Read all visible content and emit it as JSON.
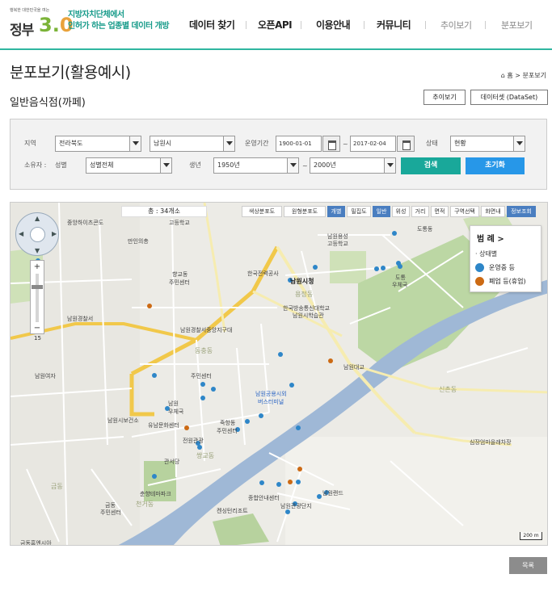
{
  "header": {
    "logo_tiny": "행복한 대한민국을 여는",
    "logo_gov": "정부",
    "logo_three": "3.",
    "logo_zero": "0",
    "slogan_line1": "지방자치단체에서",
    "slogan_line2": "인허가 하는 업종별 데이터 개방",
    "menu": [
      {
        "label": "데이터 찾기"
      },
      {
        "label": "오픈API"
      },
      {
        "label": "이용안내"
      },
      {
        "label": "커뮤니티"
      },
      {
        "label": "추이보기"
      },
      {
        "label": "분포보기"
      }
    ],
    "accent_color": "#2fb6a0"
  },
  "page": {
    "title": "분포보기(활용예시)",
    "breadcrumb": "⌂ 홈 > 분포보기",
    "subtitle": "일반음식점(까페)",
    "trend_button": "추이보기",
    "dataset_button": "데이터셋 (DataSet)"
  },
  "search": {
    "region_label": "지역",
    "province": "전라북도",
    "city": "남원시",
    "period_label": "운영기간",
    "date_from": "1900-01-01",
    "date_to": "2017-02-04",
    "status_label": "상태",
    "status_value": "현황",
    "owner_label": "소유자 :",
    "gender_label": "성별",
    "gender_value": "성별전체",
    "birth_label": "생년",
    "birth_from": "1950년",
    "birth_to": "2000년",
    "tilde": "~",
    "search_button": "검색",
    "reset_button": "초기화",
    "search_color": "#19a89a",
    "reset_color": "#2797e8"
  },
  "map": {
    "count_text": "총 : 34개소",
    "toolbar": [
      {
        "label": "색상분포도",
        "active": false
      },
      {
        "label": "원형분포도",
        "active": false
      },
      {
        "label": "개별",
        "active": true
      },
      {
        "label": "밀집도",
        "active": false
      },
      {
        "label": "일반",
        "active": true
      },
      {
        "label": "위성",
        "active": false
      },
      {
        "label": "거리",
        "active": false
      },
      {
        "label": "면적",
        "active": false
      },
      {
        "label": "구역선택",
        "active": false
      },
      {
        "label": "화면내",
        "active": false
      },
      {
        "label": "정보조회",
        "active": true
      }
    ],
    "legend_title": "범 례 >",
    "legend_sub": "· 상태별",
    "legend_items": [
      {
        "label": "운영중 등",
        "color": "#2e86c8"
      },
      {
        "label": "폐업 등(휴업)",
        "color": "#cc6a14"
      }
    ],
    "zoom_plus": "+",
    "zoom_minus": "−",
    "zoom_level": "15",
    "scale": "200 m",
    "labels": [
      {
        "text": "중앙하이츠콘도"
      },
      {
        "text": "고등학교"
      },
      {
        "text": "만인의총"
      },
      {
        "text": "향교동"
      },
      {
        "text": "주민센터"
      },
      {
        "text": "남원시청"
      },
      {
        "text": "한국전력공사"
      },
      {
        "text": "남원경찰서"
      },
      {
        "text": "남원경찰서중앙지구대"
      },
      {
        "text": "남원여자"
      },
      {
        "text": "동충동"
      },
      {
        "text": "주민센터"
      },
      {
        "text": "남원"
      },
      {
        "text": "우체국"
      },
      {
        "text": "유남문화센터"
      },
      {
        "text": "죽항동"
      },
      {
        "text": "주민센터"
      },
      {
        "text": "전원관광"
      },
      {
        "text": "남원공용시외"
      },
      {
        "text": "버스터미널"
      },
      {
        "text": "남원대교"
      },
      {
        "text": "한국방송통신대학교"
      },
      {
        "text": "남원시학습관"
      },
      {
        "text": "용정동"
      },
      {
        "text": "남원용성"
      },
      {
        "text": "고등학교"
      },
      {
        "text": "도통동"
      },
      {
        "text": "도통"
      },
      {
        "text": "우체국"
      },
      {
        "text": "신촌동"
      },
      {
        "text": "심장엄마을래차장"
      },
      {
        "text": "남원랜드"
      },
      {
        "text": "남원관광단지"
      },
      {
        "text": "종합안내센터"
      },
      {
        "text": "켄싱턴리조트"
      },
      {
        "text": "금동"
      },
      {
        "text": "금동"
      },
      {
        "text": "주민센터"
      },
      {
        "text": "천거동"
      },
      {
        "text": "금동홈엔시아"
      },
      {
        "text": "춘향테마파크"
      },
      {
        "text": "관서당"
      },
      {
        "text": "남원시보건소"
      },
      {
        "text": "동충동"
      },
      {
        "text": "쌍교동"
      },
      {
        "text": "금암공원"
      }
    ]
  },
  "footer": {
    "list_button": "목록"
  }
}
